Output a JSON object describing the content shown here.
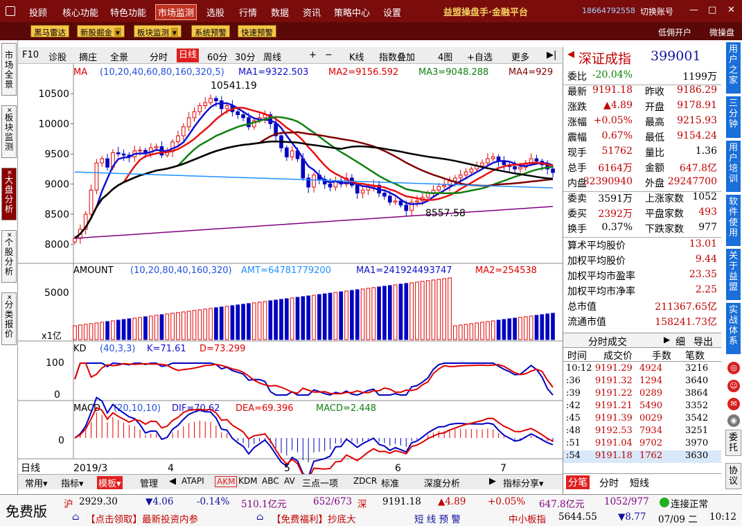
{
  "topnav": [
    "投顾",
    "核心功能",
    "特色功能",
    "市场监测",
    "选股",
    "行情",
    "数据",
    "资讯",
    "策略中心",
    "设置"
  ],
  "brand": "益盟操盘手·金融平台",
  "phone": "18664792558",
  "switch_account": "切换账号",
  "toolbar2": [
    "黑马雷达",
    "新股掘金",
    "板块监测",
    "系统预警",
    "快速预警"
  ],
  "toolbar2_right": [
    "低佣开户",
    "微操盘"
  ],
  "left_tabs": [
    "市场全景",
    "板块监测",
    "大盘分析",
    "个股分析",
    "分类报价"
  ],
  "chart_tools": [
    "F10",
    "诊股",
    "摘庄",
    "全景",
    "分时",
    "日线",
    "60分",
    "30分",
    "周线",
    "+",
    "−",
    "K线",
    "指数叠加",
    "4图",
    "+自选",
    "更多",
    "▶|"
  ],
  "main_header": {
    "name": "MA",
    "params": "(10,20,40,60,80,160,320,5)",
    "ma1": "MA1=9322.503",
    "ma2": "MA2=9156.592",
    "ma3": "MA3=9048.288",
    "ma4": "MA4=929"
  },
  "amount_header": {
    "name": "AMOUNT",
    "params": "(10,20,80,40,160,320)",
    "amt": "AMT=64781779200",
    "ma1": "MA1=241924493747",
    "ma2": "MA2=254538"
  },
  "kd_header": {
    "name": "KD",
    "params": "(40,3,3)",
    "k": "K=71.61",
    "d": "D=73.299"
  },
  "macd_header": {
    "name": "MACD",
    "params": "(20,10,10)",
    "dif": "DIF=70.62",
    "dea": "DEA=69.396",
    "macd": "MACD=2.448"
  },
  "price_axis": [
    "10500",
    "10000",
    "9500",
    "9000",
    "8500",
    "8000"
  ],
  "amount_axis": [
    "5000",
    "x1亿"
  ],
  "kd_axis": [
    "100",
    "0"
  ],
  "macd_axis": [
    "0"
  ],
  "date_axis": [
    "日线",
    "2019/3",
    "4",
    "5",
    "6",
    "7"
  ],
  "annotations": {
    "high": "10541.19",
    "low": "8557.58"
  },
  "quote": {
    "name": "深证成指",
    "code": "399001",
    "rows": [
      [
        "委比",
        "-20.04%",
        "",
        "1199万"
      ],
      [
        "最新",
        "9191.18",
        "昨收",
        "9186.29"
      ],
      [
        "涨跌",
        "▲4.89",
        "开盘",
        "9178.91"
      ],
      [
        "涨幅",
        "+0.05%",
        "最高",
        "9215.93"
      ],
      [
        "震幅",
        "0.67%",
        "最低",
        "9154.24"
      ],
      [
        "现手",
        "51762",
        "量比",
        "1.36"
      ],
      [
        "总手",
        "6164万",
        "金额",
        "647.8亿"
      ],
      [
        "内盘",
        "32390940",
        "外盘",
        "29247700"
      ],
      [
        "委卖",
        "3591万",
        "上涨家数",
        "1052"
      ],
      [
        "委买",
        "2392万",
        "平盘家数",
        "493"
      ],
      [
        "换手",
        "0.37%",
        "下跌家数",
        "977"
      ]
    ],
    "stats": [
      [
        "算术平均股价",
        "13.01"
      ],
      [
        "加权平均股价",
        "9.44"
      ],
      [
        "加权平均市盈率",
        "23.35"
      ],
      [
        "加权平均市净率",
        "2.25"
      ],
      [
        "总市值",
        "211367.65亿"
      ],
      [
        "流通市值",
        "158241.73亿"
      ]
    ]
  },
  "ticks_header": {
    "title": "分时成交",
    "tabs": [
      "细",
      "导出"
    ],
    "cols": [
      "时间",
      "成交价",
      "手数",
      "笔数"
    ]
  },
  "ticks": [
    [
      "10:12",
      "9191.29",
      "4924",
      "3216"
    ],
    [
      ":36",
      "9191.32",
      "1294",
      "3640"
    ],
    [
      ":39",
      "9191.22",
      "0289",
      "3864"
    ],
    [
      ":42",
      "9191.21",
      "5490",
      "3352"
    ],
    [
      ":45",
      "9191.39",
      "0029",
      "3542"
    ],
    [
      ":48",
      "9192.53",
      "7934",
      "3251"
    ],
    [
      ":51",
      "9191.04",
      "9702",
      "3970"
    ],
    [
      ":54",
      "9191.18",
      "1762",
      "3630"
    ]
  ],
  "right_bottom_tabs": [
    "分笔",
    "分时",
    "短线"
  ],
  "right_bar": [
    "用户之家",
    "三分钟",
    "用户培训",
    "软件使用",
    "关于益盟",
    "实战体系",
    "委托",
    "协议"
  ],
  "bottom_tabs": [
    "常用",
    "指标",
    "模板",
    "管理",
    "ATAPI",
    "AKM",
    "KDM",
    "ABC",
    "AV",
    "三点一项",
    "ZDCR",
    "标准",
    "深度分析",
    "指标分享"
  ],
  "status": {
    "free": "免费版",
    "sh": "沪",
    "sh_val": "2929.30",
    "sh_chg": "▼4.06",
    "sh_pct": "-0.14%",
    "sh_amt": "510.1亿元",
    "sh_cnt": "652/673",
    "sz": "深",
    "sz_val": "9191.18",
    "sz_chg": "▲4.89",
    "sz_pct": "+0.05%",
    "sz_amt": "647.8亿元",
    "sz_cnt": "1052/977",
    "conn": "连接正常",
    "news1": "【点击领取】最新投资内参",
    "news2": "【免费福利】抄底大",
    "alert": "短 线 预 警",
    "smb": "中小板指",
    "smb_val": "5644.55",
    "smb_chg": "▼8.77",
    "date": "07/09 二",
    "time": "10:12"
  },
  "colors": {
    "up": "#e00000",
    "down": "#0000c0",
    "brand": "#7a0c0c"
  },
  "chart_data": {
    "type": "candlestick",
    "title": "",
    "ylim": [
      7800,
      10650
    ],
    "x_labels": [
      "2019/3",
      "4",
      "5",
      "6",
      "7"
    ],
    "highlight_high": 10541.19,
    "highlight_low": 8557.58,
    "close": [
      8100,
      8250,
      8500,
      8900,
      9350,
      9420,
      9280,
      9520,
      9500,
      9480,
      9450,
      9550,
      9560,
      9500,
      9600,
      9620,
      9480,
      9540,
      9700,
      9800,
      9950,
      10100,
      10200,
      10300,
      10350,
      10420,
      10380,
      10250,
      10300,
      10200,
      10150,
      10100,
      9950,
      10050,
      10100,
      10150,
      10000,
      9800,
      9600,
      9450,
      9550,
      9420,
      9100,
      8950,
      9150,
      9080,
      9000,
      8950,
      9050,
      9000,
      9100,
      8980,
      8850,
      8900,
      8950,
      8980,
      8850,
      8800,
      8700,
      8720,
      8650,
      8560,
      8700,
      8720,
      8780,
      8850,
      8900,
      8960,
      8980,
      9050,
      9100,
      9150,
      9200,
      9250,
      9300,
      9350,
      9420,
      9450,
      9380,
      9320,
      9290,
      9250,
      9280,
      9350,
      9420,
      9380,
      9320,
      9250,
      9191
    ],
    "ma_series": [
      {
        "name": "MA1",
        "color": "#1010d0"
      },
      {
        "name": "MA2",
        "color": "#e81010"
      },
      {
        "name": "MA3",
        "color": "#108010"
      },
      {
        "name": "MA4",
        "color": "#800000"
      },
      {
        "name": "MA5",
        "color": "#000000"
      },
      {
        "name": "MA6",
        "color": "#800080"
      },
      {
        "name": "MA7",
        "color": "#1e90ff"
      }
    ]
  }
}
